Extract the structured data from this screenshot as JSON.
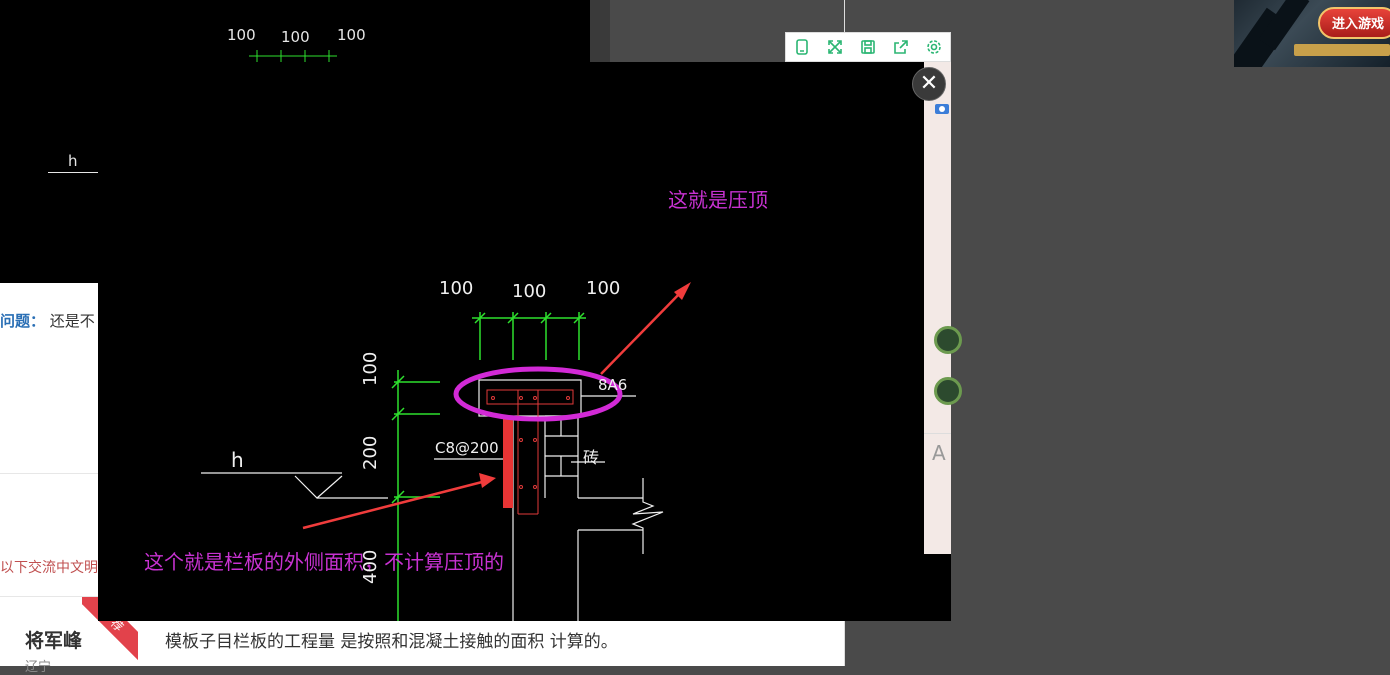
{
  "background": {
    "dimension_labels": [
      "100",
      "100",
      "100"
    ],
    "h_label": "h",
    "question_label": "问题：",
    "question_text": "还是不",
    "comment_hint": "以下交流中文明",
    "user_name": "将军峰",
    "user_sub": "辽宁",
    "ribbon_text": "荐",
    "answer_text": "模板子目栏板的工程量 是按照和混凝土接触的面积 计算的。"
  },
  "game_ad": {
    "button_label": "进入游戏"
  },
  "toolbar": {
    "icons": [
      "phone-icon",
      "expand-icon",
      "save-icon",
      "share-icon",
      "gear-icon"
    ]
  },
  "side_panel": {
    "letter": "A"
  },
  "close_button": {
    "glyph": "✕"
  },
  "drawing": {
    "annotation_top": "这就是压顶",
    "annotation_bottom": "这个就是栏板的外侧面积，不计算压顶的",
    "dim_top": [
      "100",
      "100",
      "100"
    ],
    "dim_left": [
      "100",
      "200",
      "400"
    ],
    "rebar_label": "C8@200",
    "rebar_top": "8A6",
    "brick_label": "砖",
    "h_label": "h",
    "colors": {
      "annotation": "#c832d2",
      "ellipse": "#d22ad6",
      "arrow": "#f03c3c",
      "dim_lines": "#2ee02e",
      "lines": "#f0f0f0",
      "rebar": "#e23a3a"
    }
  }
}
